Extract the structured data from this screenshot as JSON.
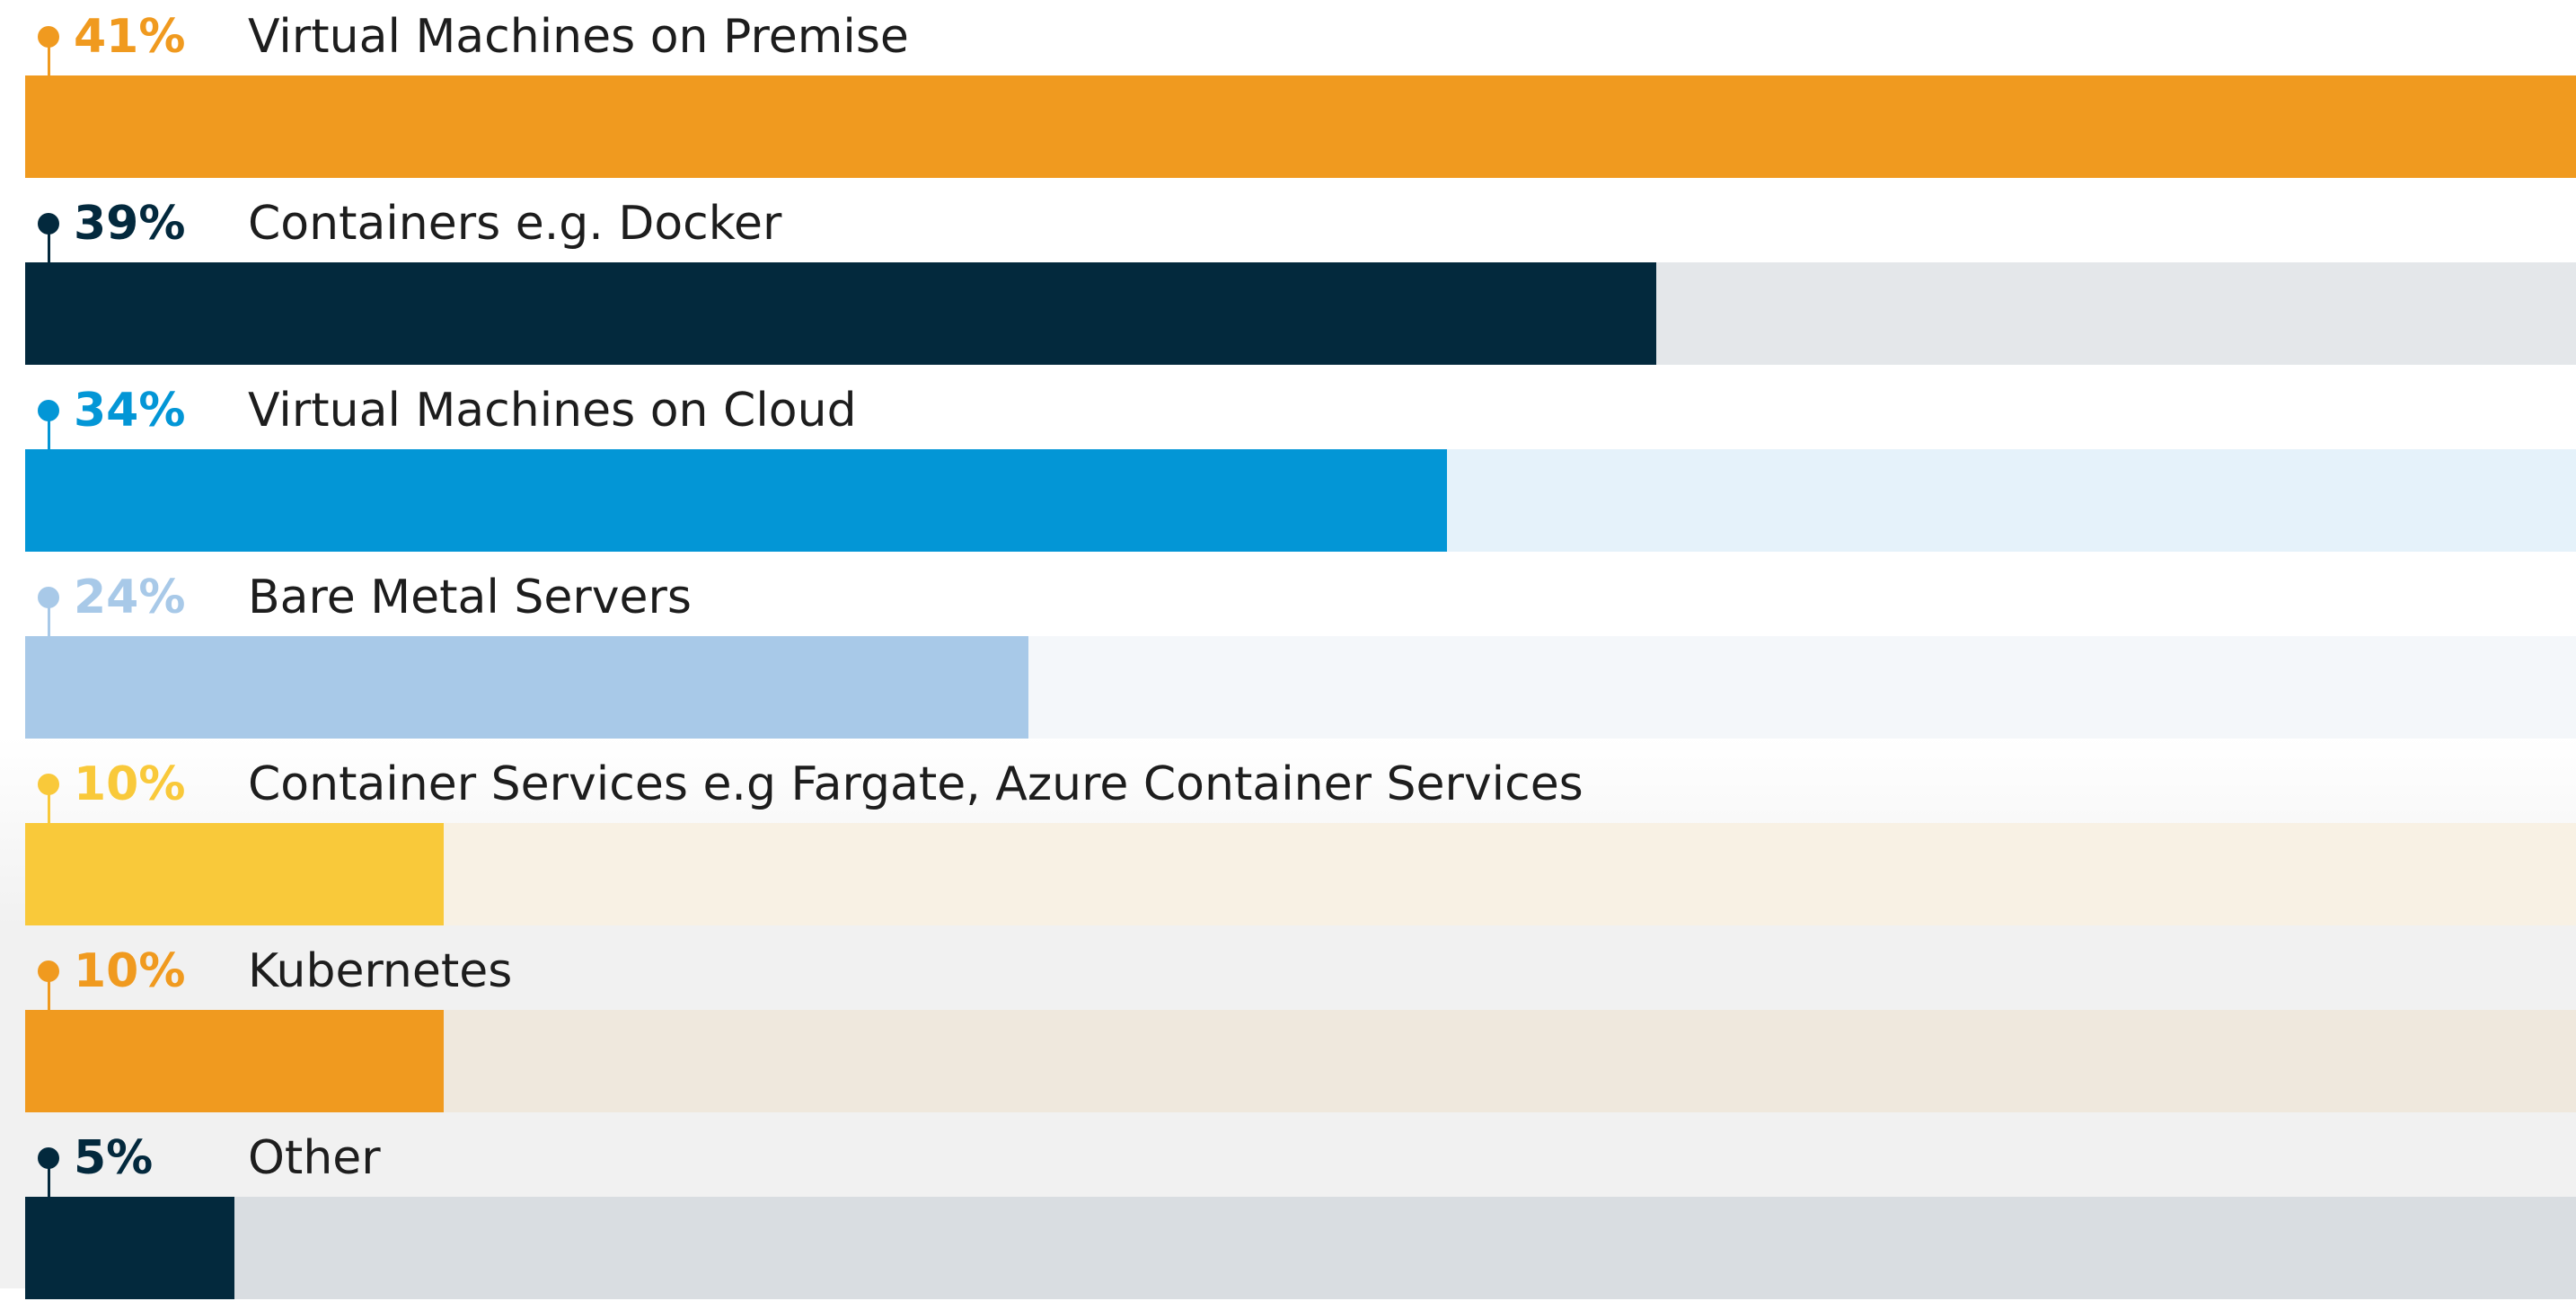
{
  "chart_data": {
    "type": "bar",
    "orientation": "horizontal",
    "categories": [
      "Virtual Machines on Premise",
      "Containers e.g. Docker",
      "Virtual Machines on Cloud",
      "Bare Metal Servers",
      "Container Services e.g Fargate, Azure Container Services",
      "Kubernetes",
      "Other"
    ],
    "values": [
      41,
      39,
      34,
      24,
      10,
      10,
      5
    ],
    "value_labels": [
      "41%",
      "39%",
      "34%",
      "24%",
      "10%",
      "10%",
      "5%"
    ],
    "value_unit": "%",
    "title": "",
    "xlabel": "",
    "ylabel": "",
    "xlim": [
      0,
      61
    ],
    "grid": false,
    "legend": "none",
    "colors": {
      "bars": [
        "#f09a1f",
        "#03293d",
        "#0396d6",
        "#a8c9e8",
        "#f9c93a",
        "#f09a1f",
        "#03293d"
      ],
      "tracks": [
        "#f09a1f",
        "#e4e7ea",
        "#e5f2fa",
        "#f4f7fa",
        "#f8f1e4",
        "#efe8dd",
        "#d9dde1"
      ]
    }
  }
}
